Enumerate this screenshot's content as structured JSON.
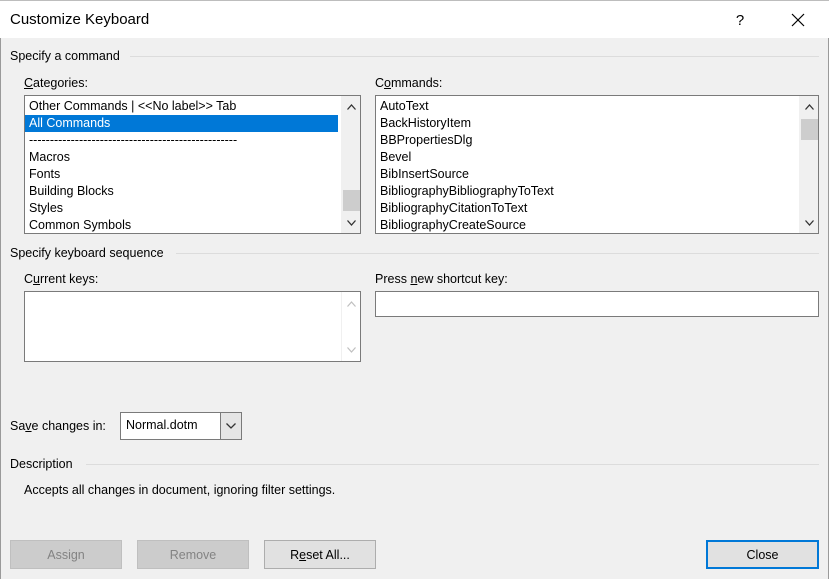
{
  "window": {
    "title": "Customize Keyboard",
    "help_label": "?",
    "close_icon": "close-x-icon"
  },
  "command_group": {
    "title": "Specify a command",
    "categories_label_prefix": "",
    "categories_label_accel": "C",
    "categories_label_rest": "ategories:",
    "commands_label_prefix": "C",
    "commands_label_accel": "o",
    "commands_label_rest": "mmands:",
    "categories": [
      "Other Commands | <<No label>> Tab",
      "All Commands",
      "--------------------------------------------------",
      "Macros",
      "Fonts",
      "Building Blocks",
      "Styles",
      "Common Symbols"
    ],
    "categories_selected": "All Commands",
    "commands": [
      "AutoText",
      "BackHistoryItem",
      "BBPropertiesDlg",
      "Bevel",
      "BibInsertSource",
      "BibliographyBibliographyToText",
      "BibliographyCitationToText",
      "BibliographyCreateSource"
    ]
  },
  "keyboard_group": {
    "title": "Specify keyboard sequence",
    "current_keys_prefix": "C",
    "current_keys_accel": "u",
    "current_keys_rest": "rrent keys:",
    "new_key_prefix": "Press ",
    "new_key_accel": "n",
    "new_key_rest": "ew shortcut key:",
    "new_key_value": ""
  },
  "save_changes": {
    "label_prefix": "Sa",
    "label_accel": "v",
    "label_rest": "e changes in:",
    "value": "Normal.dotm"
  },
  "description": {
    "title": "Description",
    "text": "Accepts all changes in document, ignoring filter settings."
  },
  "buttons": {
    "assign": "Assign",
    "remove": "Remove",
    "reset_prefix": "R",
    "reset_accel": "e",
    "reset_rest": "set All...",
    "close": "Close"
  }
}
